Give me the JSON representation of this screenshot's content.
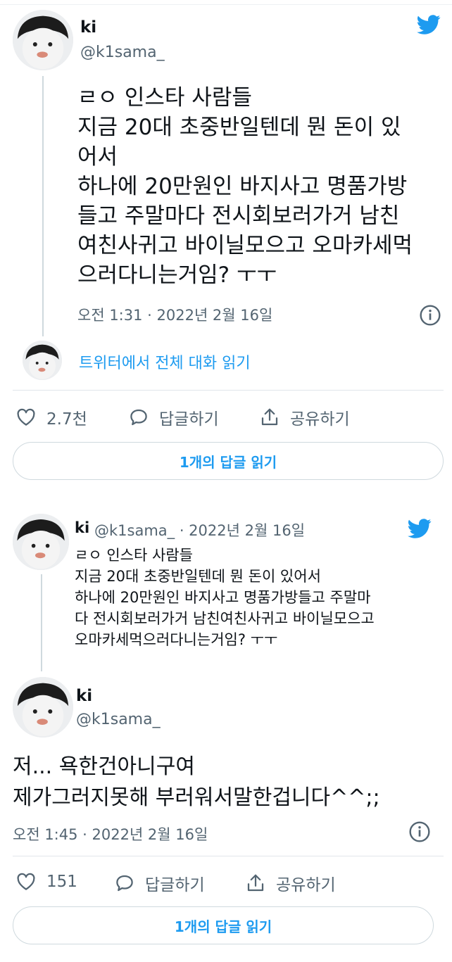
{
  "colors": {
    "accent": "#1d9bf0",
    "muted": "#536471",
    "text": "#0f1419",
    "border": "#cfd9de"
  },
  "icons": {
    "twitter": "twitter-bird-icon",
    "info": "info-circle-icon",
    "like": "heart-icon",
    "reply": "speech-bubble-icon",
    "share": "share-arrow-icon"
  },
  "tweet1": {
    "name": "ki",
    "handle": "@k1sama_",
    "text": "ㄹㅇ 인스타 사람들\n지금 20대 초중반일텐데 뭔 돈이 있\n어서\n하나에 20만원인 바지사고 명품가방\n들고 주말마다 전시회보러가거 남친\n여친사귀고 바이닐모으고 오마카세먹\n으러다니는거임? ㅜㅜ",
    "timestamp": "오전 1:31 · 2022년 2월 16일",
    "read_conversation": "트위터에서 전체 대화 읽기",
    "likes": "2.7천",
    "reply_label": "답글하기",
    "share_label": "공유하기",
    "read_replies": "1개의 답글 읽기"
  },
  "tweet2": {
    "quoted": {
      "name": "ki",
      "handle_date": "@k1sama_ · 2022년 2월 16일",
      "text": "ㄹㅇ 인스타 사람들\n지금 20대 초중반일텐데 뭔 돈이 있어서\n하나에 20만원인 바지사고 명품가방들고 주말마\n다 전시회보러가거 남친여친사귀고 바이닐모으고\n오마카세먹으러다니는거임? ㅜㅜ"
    },
    "name": "ki",
    "handle": "@k1sama_",
    "text": "저... 욕한건아니구여\n제가그러지못해 부러워서말한겁니다^^;;",
    "timestamp": "오전 1:45 · 2022년 2월 16일",
    "likes": "151",
    "reply_label": "답글하기",
    "share_label": "공유하기",
    "read_replies": "1개의 답글 읽기"
  }
}
